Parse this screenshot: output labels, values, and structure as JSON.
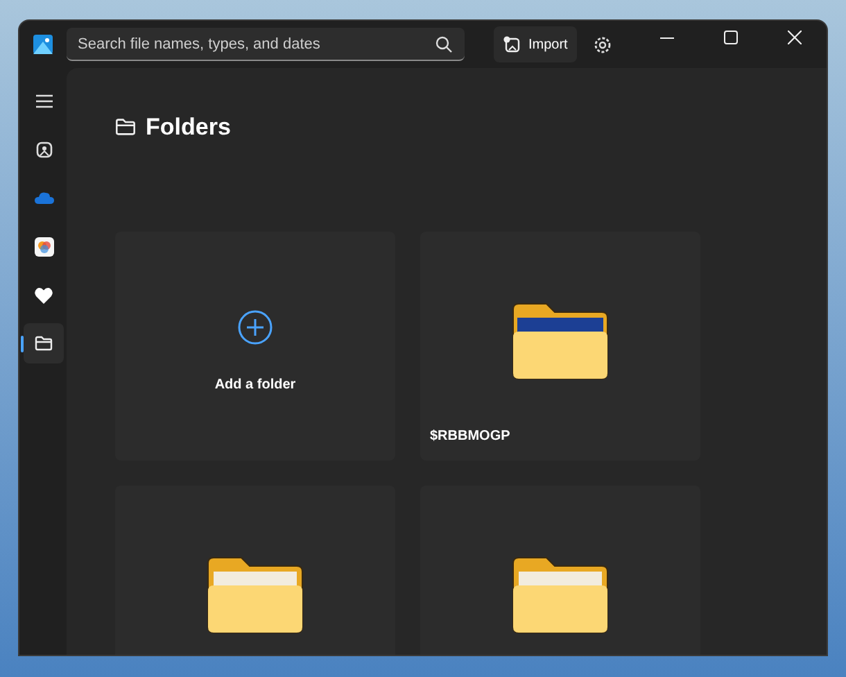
{
  "search": {
    "placeholder": "Search file names, types, and dates"
  },
  "import_button": {
    "label": "Import"
  },
  "nav": [
    {
      "kind": "menu",
      "selected": false
    },
    {
      "kind": "gallery",
      "selected": false
    },
    {
      "kind": "cloud",
      "selected": false
    },
    {
      "kind": "photos",
      "selected": false
    },
    {
      "kind": "favorites",
      "selected": false
    },
    {
      "kind": "folders",
      "selected": true
    }
  ],
  "heading": "Folders",
  "folders": [
    {
      "kind": "add",
      "label": "Add a folder"
    },
    {
      "kind": "preview",
      "name": "$RBBMOGP"
    },
    {
      "kind": "folder"
    },
    {
      "kind": "folder"
    }
  ]
}
